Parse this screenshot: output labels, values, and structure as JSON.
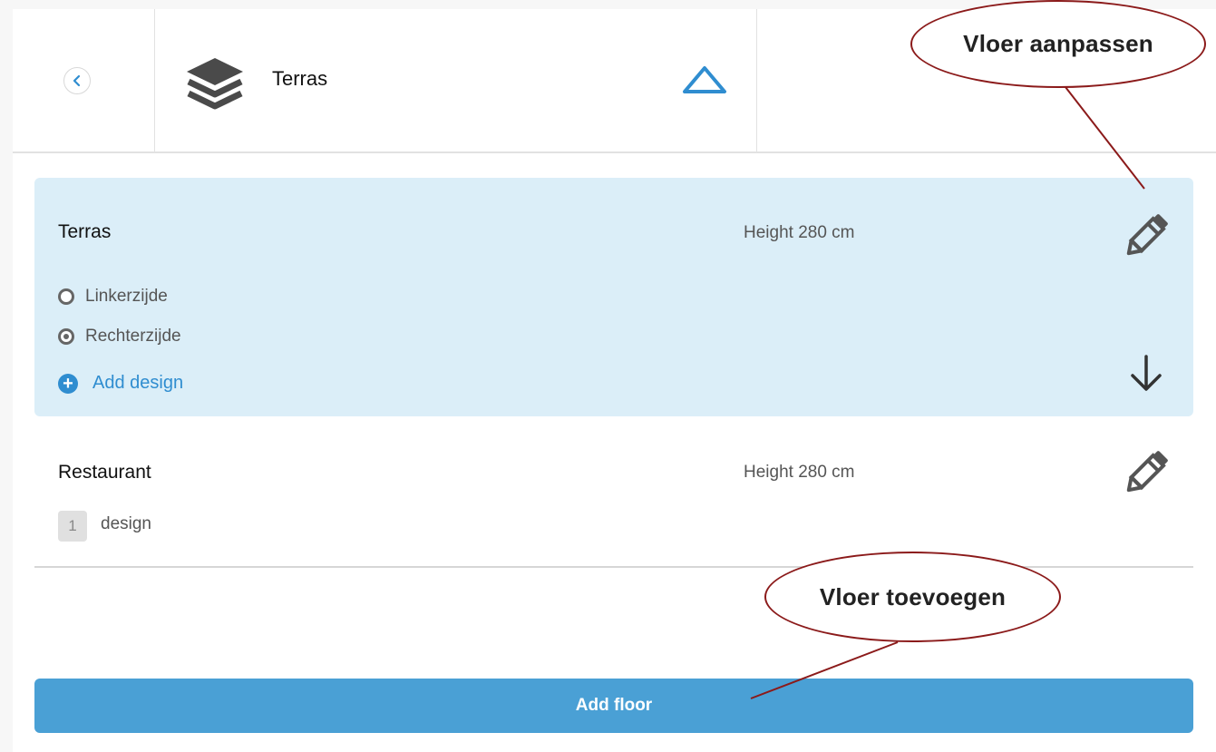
{
  "header": {
    "floor_title": "Terras"
  },
  "floors": [
    {
      "name": "Terras",
      "height": "Height 280 cm",
      "designs": [
        {
          "label": "Linkerzijde",
          "selected": false
        },
        {
          "label": "Rechterzijde",
          "selected": true
        }
      ],
      "add_design_label": "Add design"
    },
    {
      "name": "Restaurant",
      "height": "Height 280 cm",
      "design_count": "1",
      "design_count_label": "design"
    }
  ],
  "add_floor_label": "Add floor",
  "annotations": {
    "edit_floor": "Vloer aanpassen",
    "add_floor": "Vloer toevoegen"
  },
  "colors": {
    "accent": "#4aa0d5",
    "link": "#2f8dd0",
    "selected_card": "#dbeef8",
    "annotation_outline": "#8b1a1a"
  },
  "icons": [
    "chevron-left-icon",
    "layers-icon",
    "triangle-up-icon",
    "pencil-icon",
    "arrow-down-icon",
    "plus-circle-icon"
  ]
}
